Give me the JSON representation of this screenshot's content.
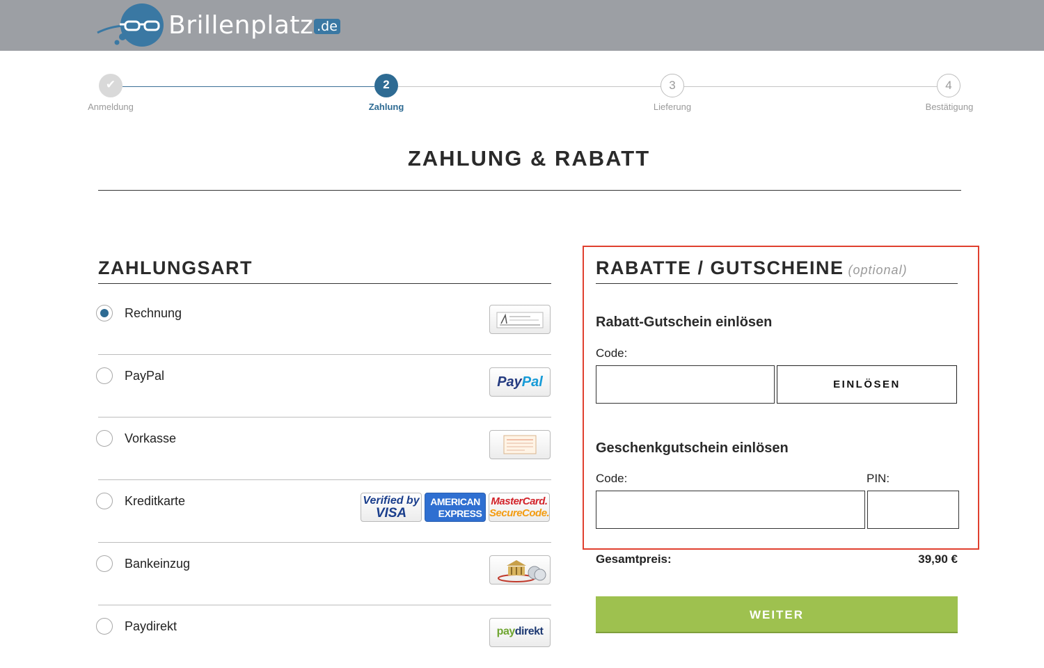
{
  "header": {
    "logo_text": "Brillenplatz",
    "logo_tld": ".de"
  },
  "stepper": {
    "steps": [
      {
        "label": "Anmeldung",
        "marker": "✔",
        "state": "done"
      },
      {
        "label": "Zahlung",
        "marker": "2",
        "state": "active"
      },
      {
        "label": "Lieferung",
        "marker": "3",
        "state": "todo"
      },
      {
        "label": "Bestätigung",
        "marker": "4",
        "state": "todo"
      }
    ]
  },
  "page_title": "ZAHLUNG & RABATT",
  "payment": {
    "title": "ZAHLUNGSART",
    "methods": [
      {
        "label": "Rechnung",
        "selected": true,
        "icon": "invoice-icon"
      },
      {
        "label": "PayPal",
        "selected": false,
        "icon": "paypal-logo"
      },
      {
        "label": "Vorkasse",
        "selected": false,
        "icon": "transfer-form-icon"
      },
      {
        "label": "Kreditkarte",
        "selected": false,
        "icon": "credit-card-logos"
      },
      {
        "label": "Bankeinzug",
        "selected": false,
        "icon": "bank-icon"
      },
      {
        "label": "Paydirekt",
        "selected": false,
        "icon": "paydirekt-logo"
      }
    ],
    "logos": {
      "paypal_a": "Pay",
      "paypal_b": "Pal",
      "visa_top": "Verified by",
      "visa_bottom": "VISA",
      "amex_top": "AMERICAN",
      "amex_bottom": "EXPRESS",
      "mc_top": "MasterCard.",
      "mc_bottom": "SecureCode.",
      "paydirekt_a": "pay",
      "paydirekt_b": "direkt"
    }
  },
  "promo": {
    "title": "RABATTE / GUTSCHEINE",
    "optional": "(optional)",
    "discount_heading": "Rabatt-Gutschein einlösen",
    "discount_code_label": "Code:",
    "discount_code_value": "",
    "redeem_button": "EINLÖSEN",
    "gift_heading": "Geschenkgutschein einlösen",
    "gift_code_label": "Code:",
    "gift_code_value": "",
    "gift_pin_label": "PIN:",
    "gift_pin_value": ""
  },
  "summary": {
    "total_label": "Gesamtpreis:",
    "total_value": "39,90 €",
    "next_button": "WEITER"
  },
  "colors": {
    "accent": "#2e6b93",
    "header_bg": "#9c9fa4",
    "highlight_border": "#e0402f",
    "next_button": "#9ec14f"
  }
}
